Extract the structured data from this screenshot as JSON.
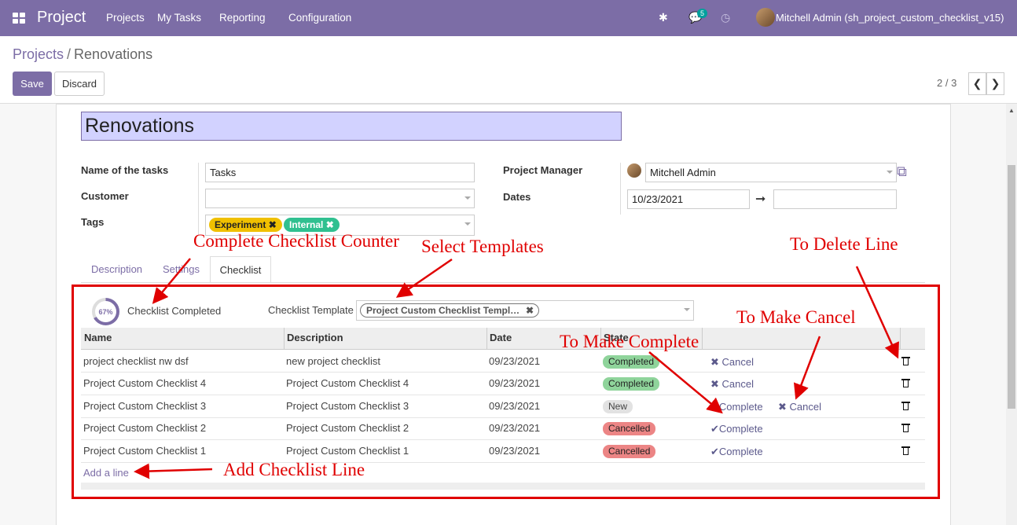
{
  "topbar": {
    "brand": "Project",
    "menus": [
      "Projects",
      "My Tasks",
      "Reporting",
      "Configuration"
    ],
    "messages_count": "5",
    "user": "Mitchell Admin (sh_project_custom_checklist_v15)"
  },
  "breadcrumb": {
    "parent": "Projects",
    "separator": "/",
    "current": "Renovations"
  },
  "buttons": {
    "save": "Save",
    "discard": "Discard"
  },
  "pager": {
    "text": "2 / 3"
  },
  "form": {
    "title": "Renovations",
    "labels": {
      "task_name": "Name of the tasks",
      "customer": "Customer",
      "tags": "Tags",
      "manager": "Project Manager",
      "dates": "Dates"
    },
    "task_name": "Tasks",
    "customer": "",
    "tags": [
      {
        "label": "Experiment",
        "color": "#f0c000"
      },
      {
        "label": "Internal",
        "color": "#30c090"
      }
    ],
    "manager": "Mitchell Admin",
    "date_start": "10/23/2021",
    "date_end": ""
  },
  "tabs": [
    "Description",
    "Settings",
    "Checklist"
  ],
  "checklist": {
    "progress_percent": 67,
    "progress_label": "67%",
    "completed_label": "Checklist Completed",
    "template_label": "Checklist Template",
    "template_value": "Project Custom Checklist Templ…",
    "columns": [
      "Name",
      "Description",
      "Date",
      "State"
    ],
    "rows": [
      {
        "name": "project checklist nw dsf",
        "description": "new project checklist",
        "date": "09/23/2021",
        "state": "Completed",
        "actions": [
          "Cancel"
        ]
      },
      {
        "name": "Project Custom Checklist 4",
        "description": "Project Custom Checklist 4",
        "date": "09/23/2021",
        "state": "Completed",
        "actions": [
          "Cancel"
        ]
      },
      {
        "name": "Project Custom Checklist 3",
        "description": "Project Custom Checklist 3",
        "date": "09/23/2021",
        "state": "New",
        "actions": [
          "Complete",
          "Cancel"
        ]
      },
      {
        "name": "Project Custom Checklist 2",
        "description": "Project Custom Checklist 2",
        "date": "09/23/2021",
        "state": "Cancelled",
        "actions": [
          "Complete"
        ]
      },
      {
        "name": "Project Custom Checklist 1",
        "description": "Project Custom Checklist 1",
        "date": "09/23/2021",
        "state": "Cancelled",
        "actions": [
          "Complete"
        ]
      }
    ],
    "add_line": "Add a line",
    "state_colors": {
      "Completed": "#8fd49b",
      "New": "#e2e2e2",
      "Cancelled": "#ec8585"
    }
  },
  "annotations": {
    "counter": "Complete Checklist Counter",
    "templates": "Select Templates",
    "delete": "To Delete Line",
    "cancel": "To Make Cancel",
    "complete": "To Make Complete",
    "add": "Add Checklist Line"
  }
}
